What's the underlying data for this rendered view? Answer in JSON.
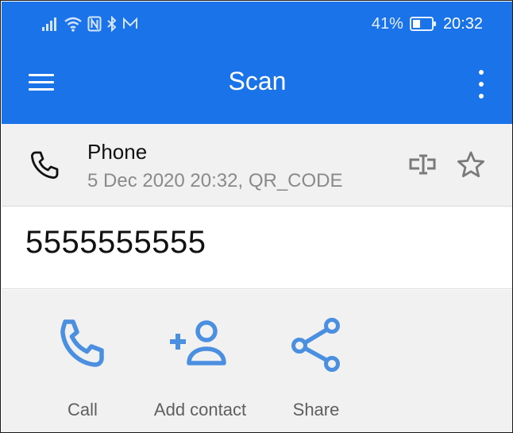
{
  "status_bar": {
    "battery_percent": "41%",
    "time": "20:32",
    "battery_level": 0.41
  },
  "toolbar": {
    "title": "Scan"
  },
  "result": {
    "type_label": "Phone",
    "meta": "5 Dec 2020 20:32, QR_CODE",
    "value": "5555555555"
  },
  "actions": [
    {
      "label": "Call",
      "icon": "phone-icon"
    },
    {
      "label": "Add contact",
      "icon": "add-contact-icon"
    },
    {
      "label": "Share",
      "icon": "share-icon"
    }
  ],
  "colors": {
    "primary": "#1a73e8",
    "action_icon": "#4a8fe0",
    "header_bg": "#f1f1f1"
  }
}
